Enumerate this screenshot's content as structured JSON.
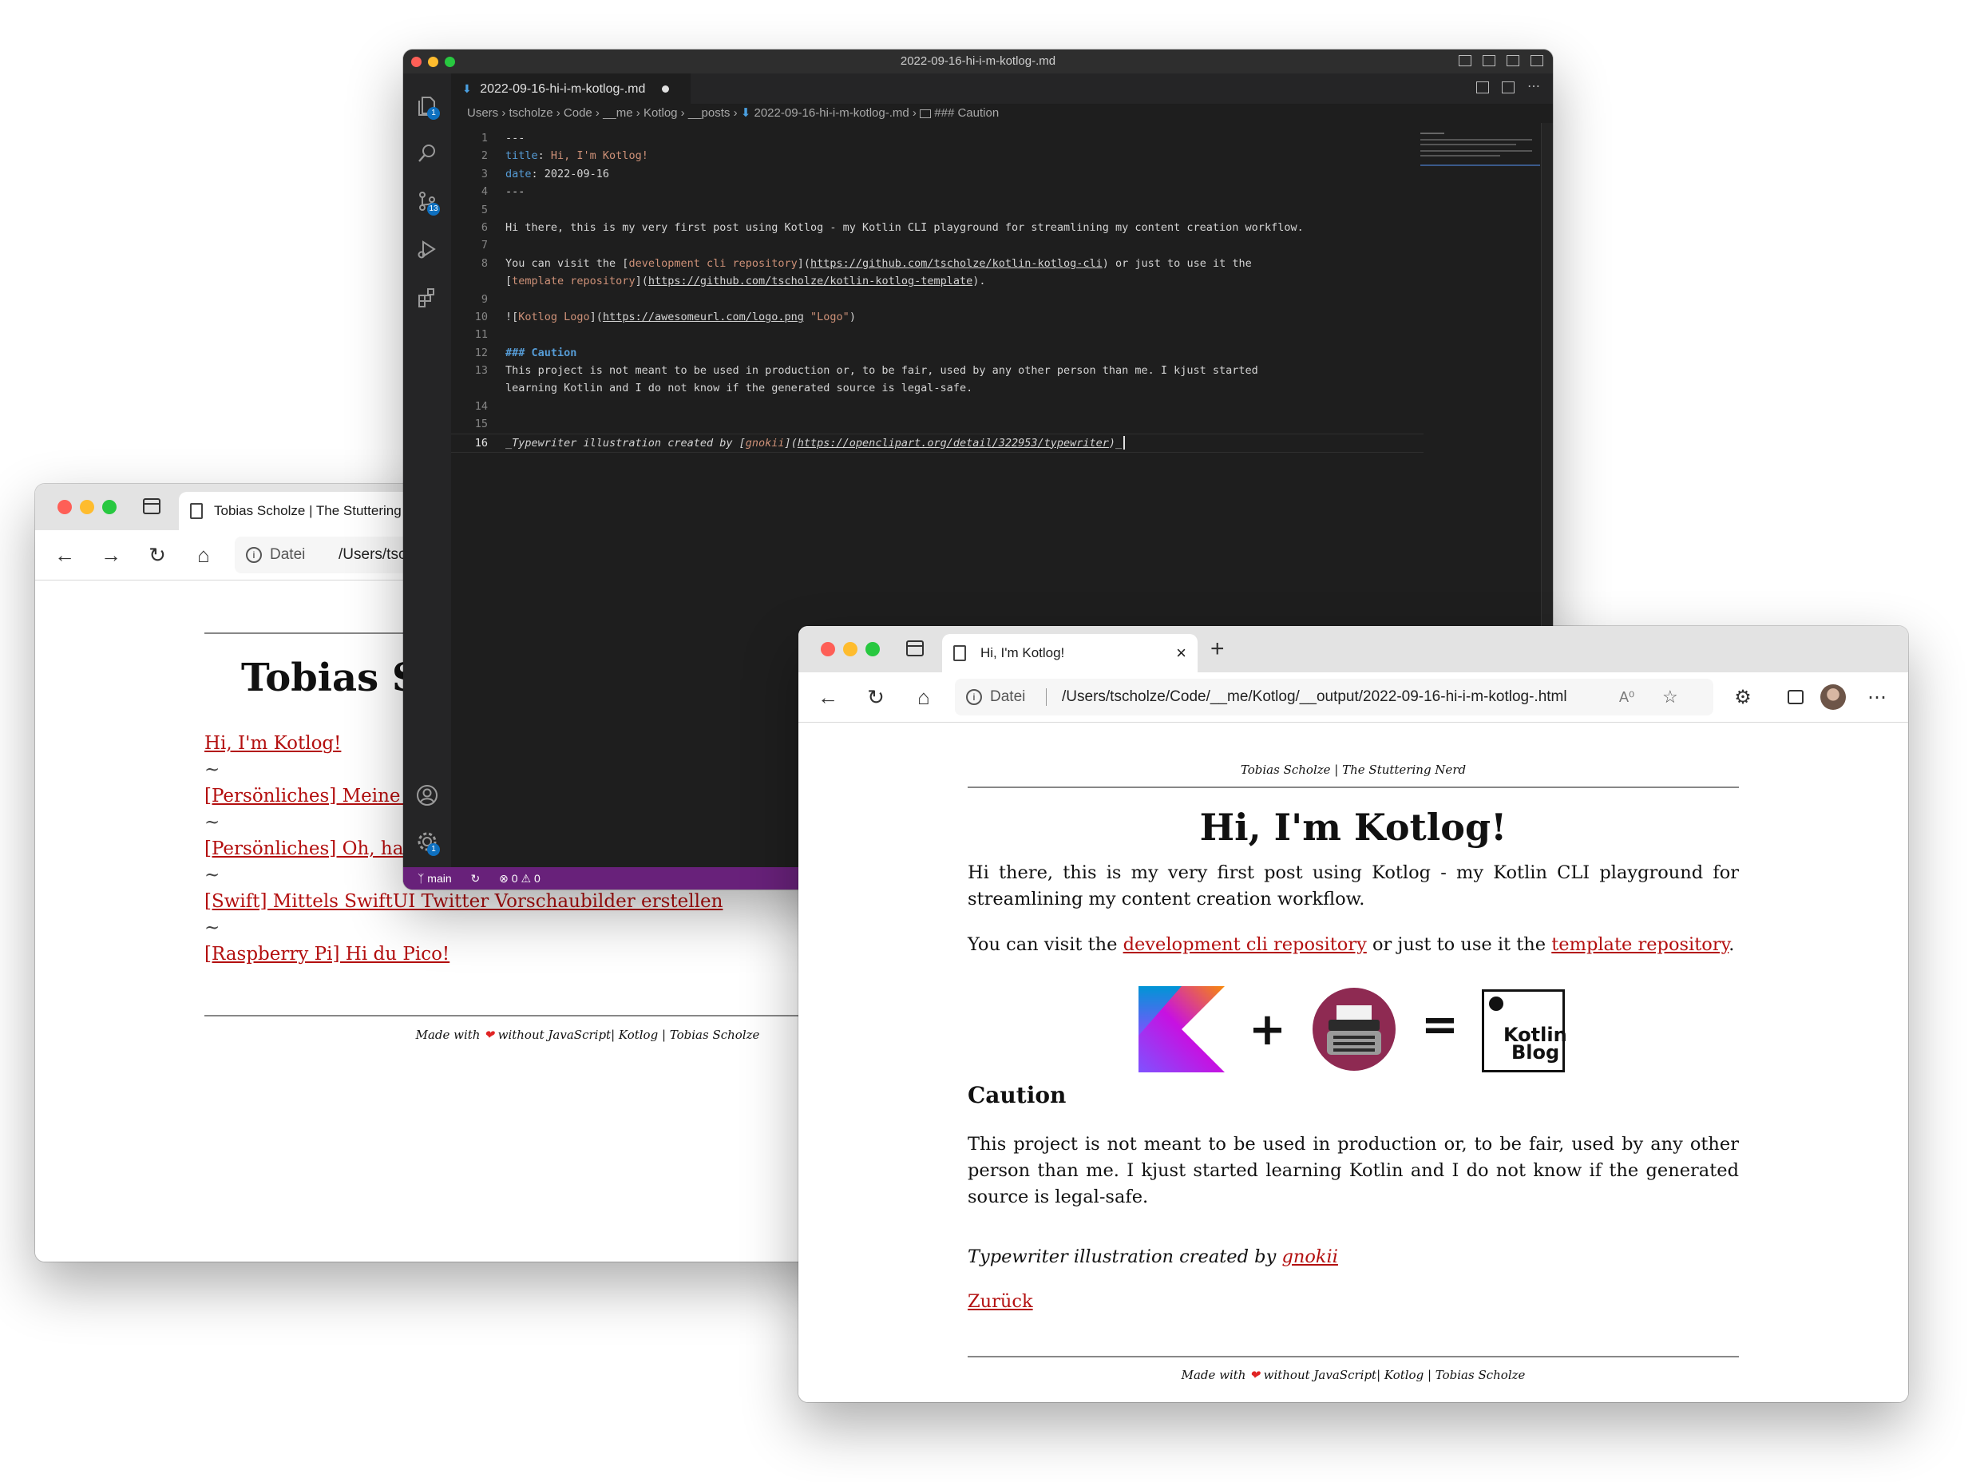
{
  "left_browser": {
    "tab_title": "Tobias Scholze | The Stuttering Nerd",
    "address_prefix": "Datei",
    "address_url": "/Users/tscholze/Code/__me/Kotlog/__output/index.html",
    "heading": "Tobias Scholze",
    "separator": "~",
    "posts": [
      "Hi, I'm Kotlog!",
      "[Persönliches] Meine Git-Repositories",
      "[Persönliches] Oh, hai Apple!",
      "[Swift] Mittels SwiftUI Twitter Vorschaubilder erstellen",
      "[Raspberry Pi] Hi du Pico!"
    ],
    "footer_prefix": "Made with",
    "footer_suffix": "without JavaScript| Kotlog | Tobias Scholze"
  },
  "vscode": {
    "window_title": "2022-09-16-hi-i-m-kotlog-.md",
    "tab_label": "2022-09-16-hi-i-m-kotlog-.md",
    "breadcrumb": [
      "Users",
      "tscholze",
      "Code",
      "__me",
      "Kotlog",
      "__posts",
      "2022-09-16-hi-i-m-kotlog-.md",
      "### Caution"
    ],
    "explorer_badge": "1",
    "scm_badge": "13",
    "settings_badge": "1",
    "status_branch": "main",
    "status_errors": "0",
    "status_warnings": "0",
    "lines": {
      "l1": "---",
      "l2_key": "title",
      "l2_val": "Hi, I'm Kotlog!",
      "l3_key": "date",
      "l3_val": "2022-09-16",
      "l4": "---",
      "l6": "Hi there, this is my very first post using Kotlog - my Kotlin CLI playground for streamlining my content creation workflow.",
      "l8a_pre": "You can visit the [",
      "l8a_text": "development cli repository",
      "l8a_mid": "](",
      "l8a_url": "https://github.com/tscholze/kotlin-kotlog-cli",
      "l8a_post": ") or just to use it the",
      "l8b_pre": "[",
      "l8b_text": "template repository",
      "l8b_mid": "](",
      "l8b_url": "https://github.com/tscholze/kotlin-kotlog-template",
      "l8b_post": ").",
      "l10_pre": "![",
      "l10_text": "Kotlog Logo",
      "l10_mid": "](",
      "l10_url": "https://awesomeurl.com/logo.png",
      "l10_title": " \"Logo\"",
      "l10_post": ")",
      "l12": "### Caution",
      "l13a": "This project is not meant to be used in production or, to be fair, used by any other person than me. I kjust started",
      "l13b": "learning Kotlin and I do not know if the generated source is legal-safe.",
      "l16_pre": "_Typewriter illustration created by [",
      "l16_text": "gnokii",
      "l16_mid": "](",
      "l16_url": "https://openclipart.org/detail/322953/typewriter",
      "l16_post": ")_"
    },
    "line_numbers": [
      "1",
      "2",
      "3",
      "4",
      "5",
      "6",
      "7",
      "8",
      "9",
      "10",
      "11",
      "12",
      "13",
      "14",
      "15",
      "16"
    ]
  },
  "right_browser": {
    "tab_title": "Hi, I'm Kotlog!",
    "new_tab": "+",
    "address_prefix": "Datei",
    "address_url": "/Users/tscholze/Code/__me/Kotlog/__output/2022-09-16-hi-i-m-kotlog-.html",
    "site_header": "Tobias Scholze | The Stuttering Nerd",
    "title": "Hi, I'm Kotlog!",
    "intro": "Hi there, this is my very first post using Kotlog - my Kotlin CLI playground for streamlining my content creation workflow.",
    "visit_pre": "You can visit the ",
    "visit_link1": "development cli repository",
    "visit_mid": " or just to use it the ",
    "visit_link2": "template repository",
    "visit_post": ".",
    "logo_plus": "+",
    "logo_equals": "=",
    "kotlin_blog_line1": "Kotlin",
    "kotlin_blog_line2": "Blog",
    "caution_heading": "Caution",
    "caution_text": "This project is not meant to be used in production or, to be fair, used by any other person than me. I kjust started learning Kotlin and I do not know if the generated source is legal-safe.",
    "credit_pre": "Typewriter illustration created by ",
    "credit_link": "gnokii",
    "back_link": "Zurück",
    "footer_prefix": "Made with",
    "footer_suffix": "without JavaScript| Kotlog | Tobias Scholze"
  },
  "colors": {
    "link": "#b30f0f",
    "vscode_status": "#68217a",
    "vscode_bg": "#1e1e1e"
  }
}
